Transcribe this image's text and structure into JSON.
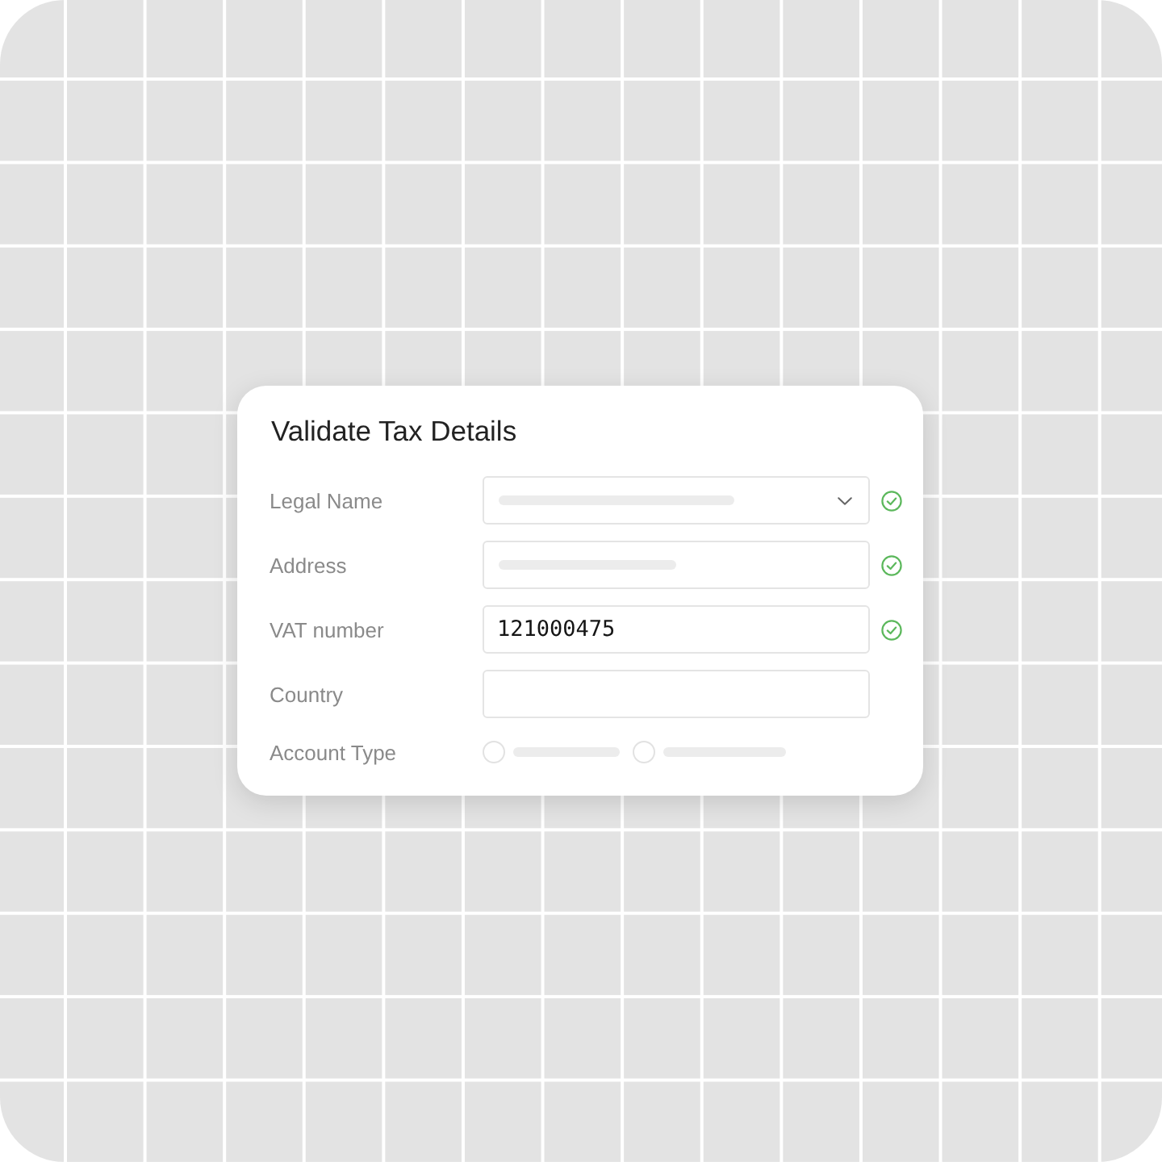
{
  "card": {
    "title": "Validate Tax Details",
    "rows": [
      {
        "label": "Legal Name",
        "kind": "select",
        "skeleton": true,
        "valid": true
      },
      {
        "label": "Address",
        "kind": "text",
        "skeleton": true,
        "valid": true
      },
      {
        "label": "VAT number",
        "kind": "text",
        "value": "121000475",
        "valid": true
      },
      {
        "label": "Country",
        "kind": "text",
        "valid": false
      },
      {
        "label": "Account Type",
        "kind": "radio",
        "options": [
          {
            "selected": false
          },
          {
            "selected": false
          }
        ],
        "valid": false
      }
    ]
  }
}
